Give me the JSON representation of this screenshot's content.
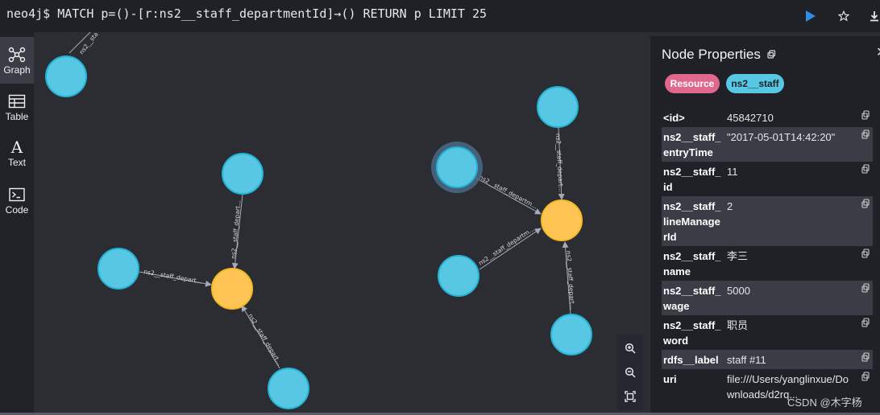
{
  "editor": {
    "query": "neo4j$ MATCH p=()-[r:ns2__staff_departmentId]→() RETURN p LIMIT 25"
  },
  "toolbar": {
    "run_icon": "play-icon",
    "favorite_icon": "star-icon",
    "download_icon": "download-icon"
  },
  "sidebar": {
    "items": [
      {
        "label": "Graph",
        "icon": "graph-icon",
        "active": true
      },
      {
        "label": "Table",
        "icon": "table-icon",
        "active": false
      },
      {
        "label": "Text",
        "icon": "text-icon",
        "active": false
      },
      {
        "label": "Code",
        "icon": "code-icon",
        "active": false
      }
    ]
  },
  "graph": {
    "edge_labels": {
      "top_left": "ns2__sta",
      "g1_top": "ns2__staff_depart...",
      "g1_left": "ns2__staff_depart...",
      "g1_bottom": "ns2__staff_depart...",
      "g2_top": "ns2__staff_depart...",
      "g2_selected": "ns2__staff_departm...",
      "g2_left": "ns2__staff_departm...",
      "g2_bottom": "ns2__staff_depart..."
    },
    "colors": {
      "staff_node": "#57c7e3",
      "staff_stroke": "#23b3d7",
      "department_node": "#ffc454",
      "department_stroke": "#f3ba25",
      "edge": "#a5abb6"
    }
  },
  "zoom": {
    "zoom_in_icon": "zoom-in-icon",
    "zoom_out_icon": "zoom-out-icon",
    "fit_icon": "fit-screen-icon"
  },
  "panel": {
    "title": "Node Properties",
    "labels": [
      "Resource",
      "ns2__staff"
    ],
    "colors": {
      "resource": "#e0688d",
      "staff": "#57c7e3"
    },
    "properties": [
      {
        "key": "<id>",
        "value": "45842710"
      },
      {
        "key": "ns2__staff_entryTime",
        "value": "\"2017-05-01T14:42:20\""
      },
      {
        "key": "ns2__staff_id",
        "value": "11"
      },
      {
        "key": "ns2__staff_lineManagerId",
        "value": "2"
      },
      {
        "key": "ns2__staff_name",
        "value": "李三"
      },
      {
        "key": "ns2__staff_wage",
        "value": "5000"
      },
      {
        "key": "ns2__staff_word",
        "value": "职员"
      },
      {
        "key": "rdfs__label",
        "value": "staff #11"
      },
      {
        "key": "uri",
        "value": "file:///Users/yanglinxue/Downloads/d2rq..."
      }
    ]
  },
  "watermark": "CSDN @木字杨"
}
